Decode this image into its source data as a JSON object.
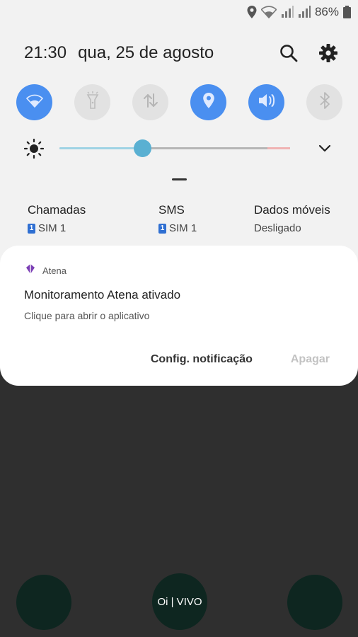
{
  "status_bar": {
    "icons": [
      "location-icon",
      "wifi-icon",
      "signal-sim1-icon",
      "signal-sim2-icon",
      "battery-icon"
    ],
    "battery_percent": "86%"
  },
  "header": {
    "time": "21:30",
    "date": "qua, 25 de agosto",
    "icons": [
      "search-icon",
      "settings-icon"
    ]
  },
  "quick_toggles": [
    {
      "name": "wifi",
      "icon": "wifi-icon",
      "state": "on"
    },
    {
      "name": "flashlight",
      "icon": "flashlight-icon",
      "state": "off"
    },
    {
      "name": "mobile-data",
      "icon": "data-transfer-icon",
      "state": "off"
    },
    {
      "name": "location",
      "icon": "location-icon",
      "state": "on"
    },
    {
      "name": "sound",
      "icon": "sound-icon",
      "state": "on"
    },
    {
      "name": "bluetooth",
      "icon": "bluetooth-icon",
      "state": "off"
    }
  ],
  "brightness": {
    "level": 0.36
  },
  "sim_info": [
    {
      "title": "Chamadas",
      "subtitle": "SIM 1",
      "badge": "1"
    },
    {
      "title": "SMS",
      "subtitle": "SIM 1",
      "badge": "1"
    },
    {
      "title": "Dados móveis",
      "subtitle": "Desligado"
    }
  ],
  "notification": {
    "app_name": "Atena",
    "title": "Monitoramento Atena ativado",
    "text": "Clique para abrir o aplicativo",
    "actions": {
      "settings": "Config. notificação",
      "clear": "Apagar"
    }
  },
  "operator": "Oi | VIVO",
  "colors": {
    "accent": "#4a8ff0",
    "toggle_off": "#e2e2e2",
    "slider_thumb": "#5ab0d2",
    "app_icon": "#7b3fb5"
  }
}
